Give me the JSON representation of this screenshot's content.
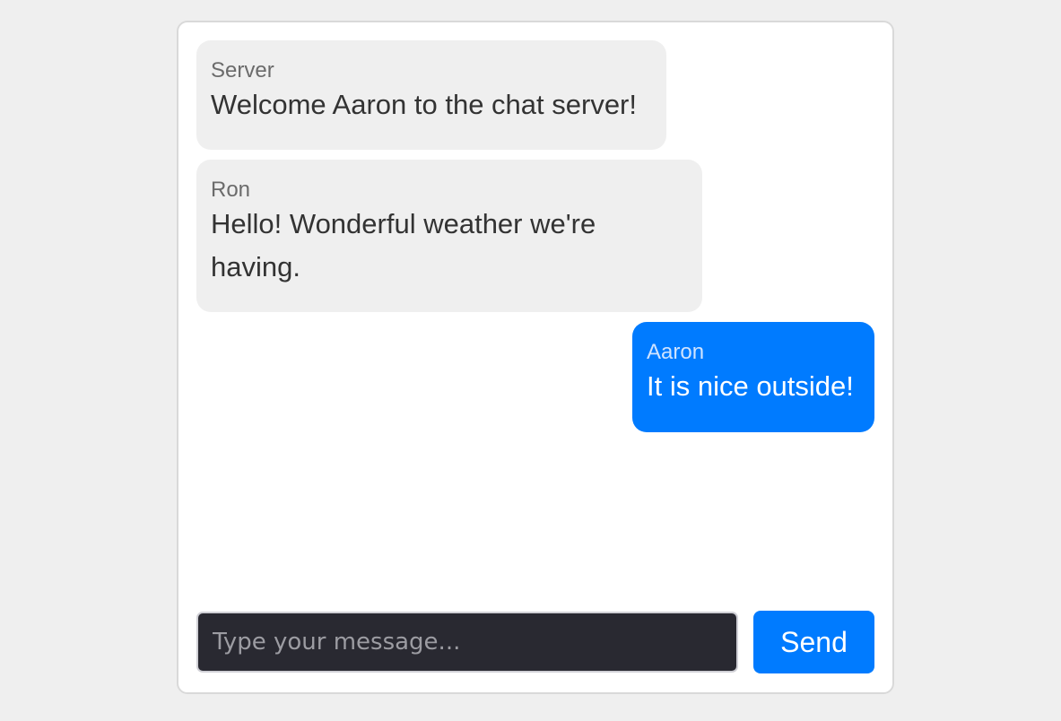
{
  "messages": [
    {
      "sender": "Server",
      "text": "Welcome Aaron to the chat server!",
      "direction": "incoming"
    },
    {
      "sender": "Ron",
      "text": "Hello! Wonderful weather we're having.",
      "direction": "incoming"
    },
    {
      "sender": "Aaron",
      "text": "It is nice outside!",
      "direction": "outgoing"
    }
  ],
  "composer": {
    "placeholder": "Type your message...",
    "value": "",
    "send_label": "Send"
  },
  "colors": {
    "page_background": "#efefef",
    "accent": "#007bff",
    "incoming_bubble": "#efefef",
    "input_background": "#292931"
  }
}
